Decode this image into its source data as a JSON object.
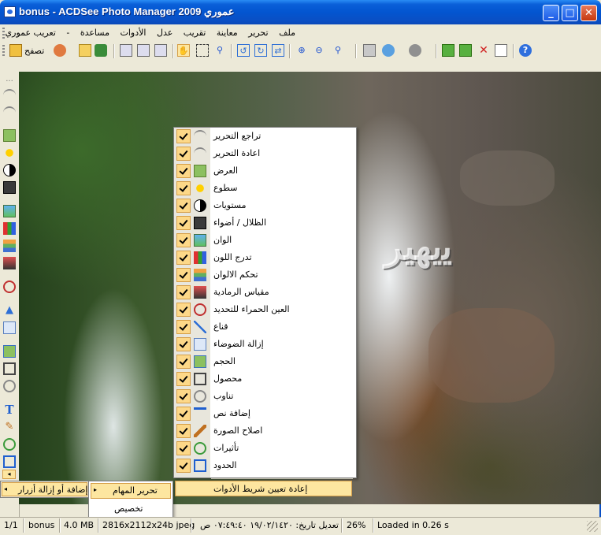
{
  "window": {
    "title": "bonus - ACDSee Photo Manager 2009 عموري",
    "minimize_glyph": "_",
    "maximize_glyph": "□",
    "close_glyph": "✕"
  },
  "menubar": {
    "items": [
      "ملف",
      "تحرير",
      "معاينة",
      "تقريب",
      "عدل",
      "الأدوات",
      "مساعدة",
      "-",
      "تعريب عموري"
    ]
  },
  "toolbar": {
    "browse_label": "تصفح"
  },
  "context_menu": {
    "items": [
      {
        "label": "تراجع التحرير",
        "icon": "undo-icon",
        "checked": true
      },
      {
        "label": "اعادة التحرير",
        "icon": "redo-icon",
        "checked": true
      },
      {
        "label": "العرض",
        "icon": "exposure-icon",
        "checked": true
      },
      {
        "label": "سطوع",
        "icon": "brightness-icon",
        "checked": true
      },
      {
        "label": "مستويات",
        "icon": "levels-icon",
        "checked": true
      },
      {
        "label": "الظلال / أضواء",
        "icon": "shadows-highlights-icon",
        "checked": true
      },
      {
        "label": "الوان",
        "icon": "color-icon",
        "checked": true
      },
      {
        "label": "تدرج اللون",
        "icon": "color-gradient-icon",
        "checked": true
      },
      {
        "label": "تحكم الالوان",
        "icon": "color-control-icon",
        "checked": true
      },
      {
        "label": "مقياس الرمادية",
        "icon": "grayscale-icon",
        "checked": true
      },
      {
        "label": "العين الحمراء للتحديد",
        "icon": "red-eye-icon",
        "checked": true
      },
      {
        "label": "قناع",
        "icon": "sharpen-mask-icon",
        "checked": true
      },
      {
        "label": "إزالة الضوضاء",
        "icon": "noise-removal-icon",
        "checked": true
      },
      {
        "label": "الحجم",
        "icon": "resize-icon",
        "checked": true
      },
      {
        "label": "محصول",
        "icon": "crop-icon",
        "checked": true
      },
      {
        "label": "تناوب",
        "icon": "rotate-icon",
        "checked": true
      },
      {
        "label": "إضافة نص",
        "icon": "text-icon",
        "checked": true
      },
      {
        "label": "اصلاح الصورة",
        "icon": "repair-icon",
        "checked": true
      },
      {
        "label": "تأثيرات",
        "icon": "effects-icon",
        "checked": true
      },
      {
        "label": "الحدود",
        "icon": "borders-icon",
        "checked": true
      }
    ],
    "reset_label": "إعادة تعيين شريط الأدوات"
  },
  "submenu_left": {
    "label": "إضافة أو إزالة أزرار"
  },
  "submenu_right": {
    "items": [
      "تحرير المهام",
      "تخصيص"
    ]
  },
  "statusbar": {
    "index": "1/1",
    "name": "bonus",
    "size": "4.0 MB",
    "dimensions": "2816x2112x24b jpeg",
    "modified": "تعديل تاريخ: ١٩/٠٢/١٤٢٠ ٠٧:٤٩:٤٠ ص",
    "zoom": "26%",
    "load_time": "Loaded in 0.26 s"
  },
  "watermark": "ﯾﯾﮭﯿﺮ",
  "colors": {
    "title_blue": "#0355d0",
    "menu_highlight": "#fde6a0",
    "check_bg": "#fdd888"
  }
}
